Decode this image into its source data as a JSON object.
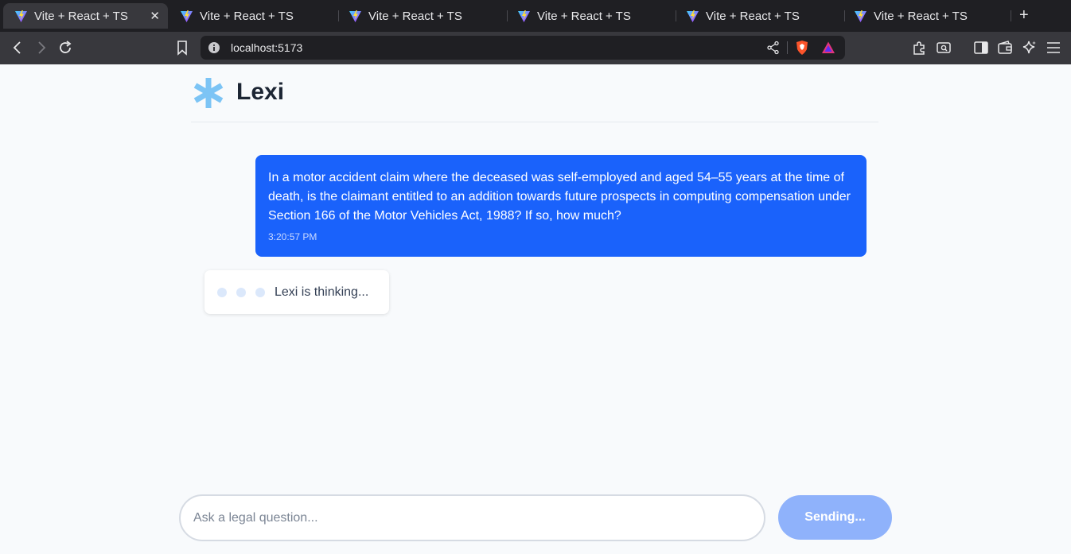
{
  "browser": {
    "tabs": [
      {
        "title": "Vite + React + TS",
        "active": true
      },
      {
        "title": "Vite + React + TS",
        "active": false
      },
      {
        "title": "Vite + React + TS",
        "active": false
      },
      {
        "title": "Vite + React + TS",
        "active": false
      },
      {
        "title": "Vite + React + TS",
        "active": false
      },
      {
        "title": "Vite + React + TS",
        "active": false
      }
    ],
    "url": "localhost:5173"
  },
  "app": {
    "title": "Lexi",
    "brand_color": "#7cc4f5"
  },
  "chat": {
    "user_message": {
      "text": "In a motor accident claim where the deceased was self-employed and aged 54–55 years at the time of death, is the claimant entitled to an addition towards future prospects in computing compensation under Section 166 of the Motor Vehicles Act, 1988? If so, how much?",
      "time": "3:20:57 PM",
      "bubble_color": "#1a62fb"
    },
    "assistant_status": "Lexi is thinking..."
  },
  "composer": {
    "placeholder": "Ask a legal question...",
    "value": "",
    "send_label": "Sending..."
  }
}
